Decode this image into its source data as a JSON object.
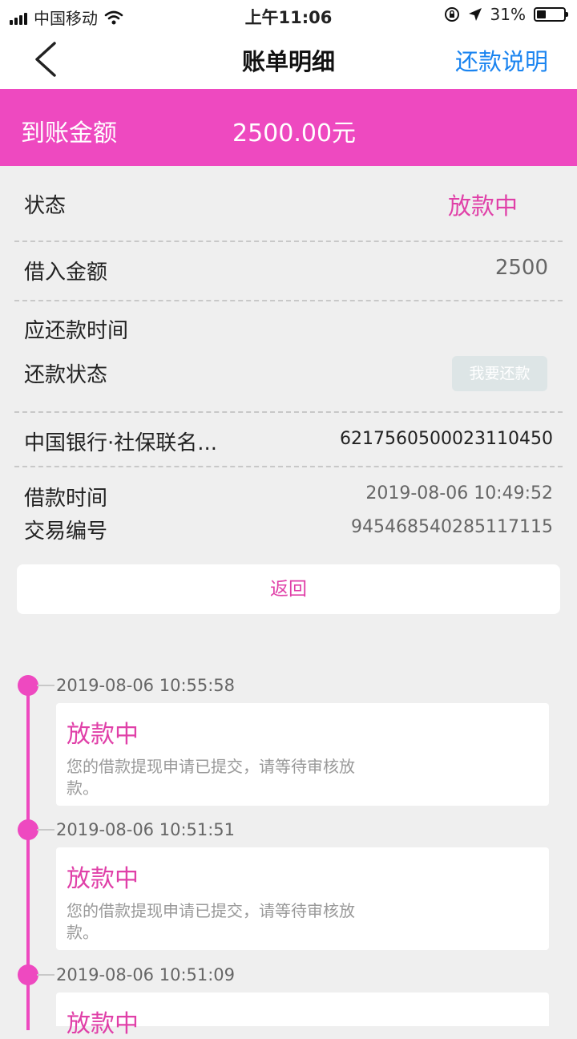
{
  "status_bar": {
    "carrier": "中国移动",
    "time": "上午11:06",
    "battery": "31%"
  },
  "nav": {
    "title": "账单明细",
    "right_action": "还款说明"
  },
  "amount": {
    "label": "到账金额",
    "value": "2500.00元"
  },
  "details": {
    "status_label": "状态",
    "status_value": "放款中",
    "borrow_amount_label": "借入金额",
    "borrow_amount_value": "2500",
    "due_time_label": "应还款时间",
    "repay_status_label": "还款状态",
    "repay_button": "我要还款",
    "bank_name": "中国银行·社保联名...",
    "card_number": "6217560500023110450",
    "loan_time_label": "借款时间",
    "loan_time_value": "2019-08-06 10:49:52",
    "trade_no_label": "交易编号",
    "trade_no_value": "945468540285117115"
  },
  "return_button": "返回",
  "timeline": [
    {
      "time": "2019-08-06 10:55:58",
      "title": "放款中",
      "desc": "您的借款提现申请已提交，请等待审核放款。"
    },
    {
      "time": "2019-08-06 10:51:51",
      "title": "放款中",
      "desc": "您的借款提现申请已提交，请等待审核放款。"
    },
    {
      "time": "2019-08-06 10:51:09",
      "title": "放款中",
      "desc": ""
    }
  ],
  "colors": {
    "accent": "#ee49c0",
    "link": "#1a84f0",
    "background": "#efefef"
  }
}
